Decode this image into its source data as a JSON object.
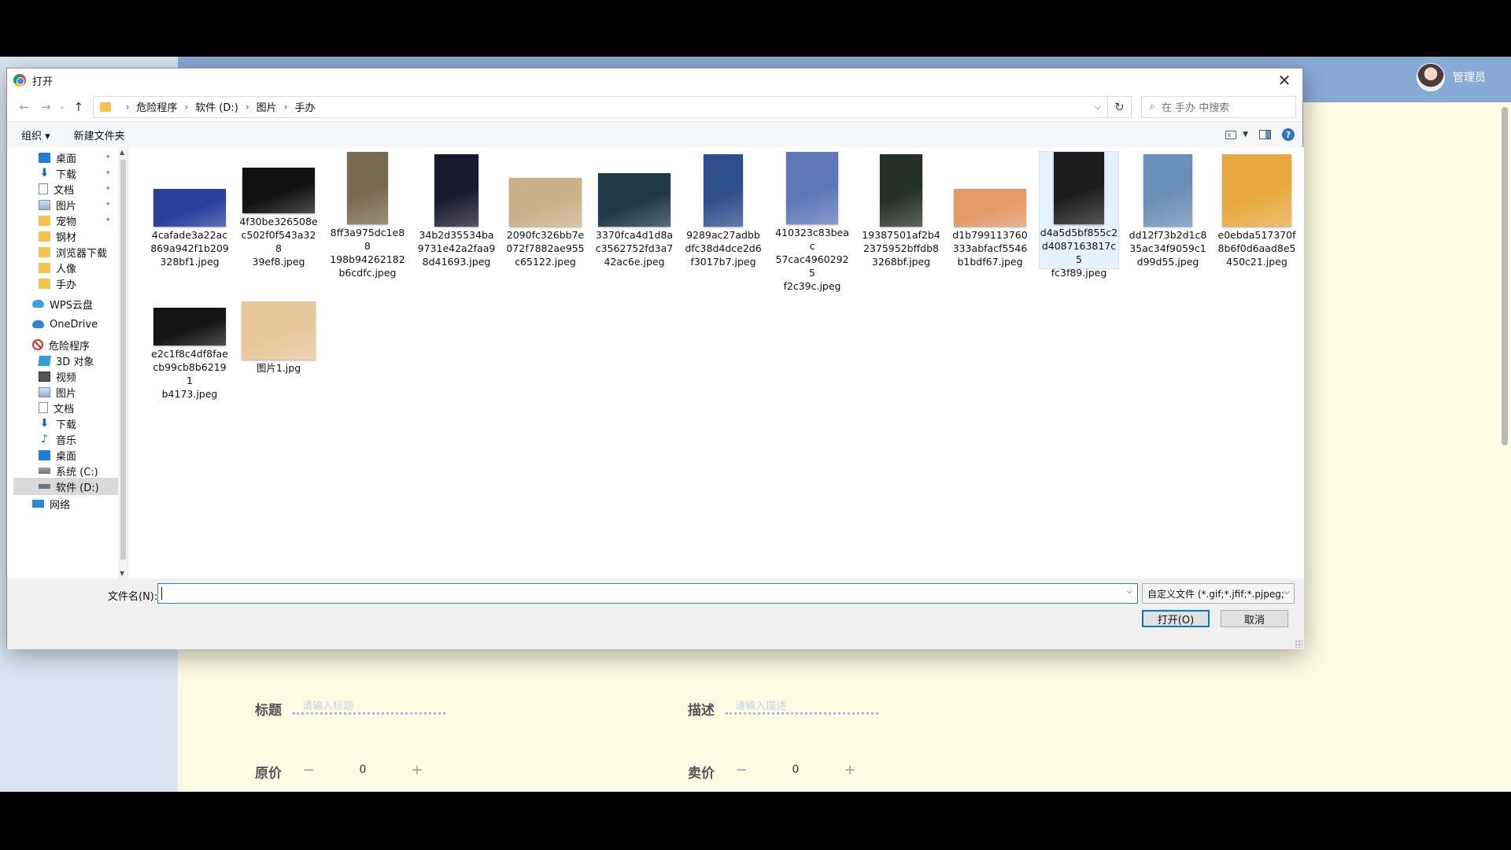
{
  "app": {
    "user_name": "管理员",
    "form": {
      "title_label": "标题",
      "title_placeholder": "请输入标题",
      "desc_label": "描述",
      "desc_placeholder": "请输入描述",
      "orig_price_label": "原价",
      "orig_price_value": "0",
      "sale_price_label": "卖价",
      "sale_price_value": "0",
      "minus": "−",
      "plus": "+"
    }
  },
  "dialog": {
    "title": "打开",
    "close": "✕",
    "nav": {
      "back": "←",
      "forward": "→",
      "recent": "⌄",
      "up": "↑"
    },
    "breadcrumb": [
      "危险程序",
      "软件 (D:)",
      "图片",
      "手办"
    ],
    "crumb_sep": "›",
    "address_dropdown": "⌵",
    "refresh": "↻",
    "search_placeholder": "在 手办 中搜索",
    "search_icon": "⌕",
    "toolbar": {
      "organize": "组织 ▾",
      "new_folder": "新建文件夹",
      "help": "?"
    },
    "sidebar": [
      {
        "label": "桌面",
        "icon": "desktop-icon",
        "pinned": true
      },
      {
        "label": "下载",
        "icon": "download-icon",
        "pinned": true
      },
      {
        "label": "文档",
        "icon": "document-icon",
        "pinned": true
      },
      {
        "label": "图片",
        "icon": "picture-icon",
        "pinned": true
      },
      {
        "label": "宠物",
        "icon": "folder-icon",
        "pinned": true
      },
      {
        "label": "钢材",
        "icon": "folder-icon",
        "pinned": false
      },
      {
        "label": "浏览器下载",
        "icon": "folder-icon",
        "pinned": false
      },
      {
        "label": "人像",
        "icon": "folder-icon",
        "pinned": false
      },
      {
        "label": "手办",
        "icon": "folder-icon",
        "pinned": false
      },
      {
        "label": "WPS云盘",
        "icon": "wps-cloud-icon",
        "pinned": false
      },
      {
        "label": "OneDrive",
        "icon": "onedrive-icon",
        "pinned": false
      },
      {
        "label": "危险程序",
        "icon": "blocked-icon",
        "pinned": false
      },
      {
        "label": "3D 对象",
        "icon": "3d-objects-icon",
        "pinned": false
      },
      {
        "label": "视频",
        "icon": "video-icon",
        "pinned": false
      },
      {
        "label": "图片",
        "icon": "picture-icon",
        "pinned": false
      },
      {
        "label": "文档",
        "icon": "document-icon",
        "pinned": false
      },
      {
        "label": "下载",
        "icon": "download-icon",
        "pinned": false
      },
      {
        "label": "音乐",
        "icon": "music-icon",
        "pinned": false
      },
      {
        "label": "桌面",
        "icon": "desktop-icon",
        "pinned": false
      },
      {
        "label": "系统 (C:)",
        "icon": "drive-c-icon",
        "pinned": false
      },
      {
        "label": "软件 (D:)",
        "icon": "drive-d-icon",
        "pinned": false,
        "selected": true
      },
      {
        "label": "网络",
        "icon": "network-icon",
        "pinned": false
      }
    ],
    "pin_glyph": "📌",
    "files": [
      {
        "name": "4cafade3a22ac869a942f1b209328bf1.jpeg",
        "line1": "4cafade3a22ac",
        "line2": "869a942f1b209",
        "line3": "328bf1.jpeg",
        "color": "#2a3f9c"
      },
      {
        "name": "4f30be326508ec502f0f543a32839ef8.jpeg",
        "line1": "4f30be326508e",
        "line2": "c502f0f543a328",
        "line3": "39ef8.jpeg",
        "color": "#111111"
      },
      {
        "name": "8ff3a975dc1e88198b94262182b6cdfc.jpeg",
        "line1": "8ff3a975dc1e88",
        "line2": "198b94262182",
        "line3": "b6cdfc.jpeg",
        "color": "#7a6a50"
      },
      {
        "name": "34b2d35534ba9731e42a2faa98d41693.jpeg",
        "line1": "34b2d35534ba",
        "line2": "9731e42a2faa9",
        "line3": "8d41693.jpeg",
        "color": "#1a1a2e"
      },
      {
        "name": "2090fc326bb7e072f7882ae955c65122.jpeg",
        "line1": "2090fc326bb7e",
        "line2": "072f7882ae955",
        "line3": "c65122.jpeg",
        "color": "#c9b28a"
      },
      {
        "name": "3370fca4d1d8ac3562752fd3a742ac6e.jpeg",
        "line1": "3370fca4d1d8a",
        "line2": "c3562752fd3a7",
        "line3": "42ac6e.jpeg",
        "color": "#1f3a44"
      },
      {
        "name": "9289ac27adbbdfc38d4dce2d6f3017b7.jpeg",
        "line1": "9289ac27adbb",
        "line2": "dfc38d4dce2d6",
        "line3": "f3017b7.jpeg",
        "color": "#2e4e8c"
      },
      {
        "name": "410323c83beac57cac49602925f2c39c.jpeg",
        "line1": "410323c83beac",
        "line2": "57cac49602925",
        "line3": "f2c39c.jpeg",
        "color": "#5f77b8"
      },
      {
        "name": "19387501af2b42375952bffdb83268bf.jpeg",
        "line1": "19387501af2b4",
        "line2": "2375952bffdb8",
        "line3": "3268bf.jpeg",
        "color": "#253028"
      },
      {
        "name": "d1b799113760333abfacf5546b1bdf67.jpeg",
        "line1": "d1b799113760",
        "line2": "333abfacf5546",
        "line3": "b1bdf67.jpeg",
        "color": "#e39a6b"
      },
      {
        "name": "d4a5d5bf855c2d4087163817c5fc3f89.jpeg",
        "line1": "d4a5d5bf855c2",
        "line2": "d4087163817c5",
        "line3": "fc3f89.jpeg",
        "color": "#1c1c1c",
        "selected": true
      },
      {
        "name": "dd12f73b2d1c835ac34f9059c1d99d55.jpeg",
        "line1": "dd12f73b2d1c8",
        "line2": "35ac34f9059c1",
        "line3": "d99d55.jpeg",
        "color": "#6a8fb6"
      },
      {
        "name": "e0ebda517370f8b6f0d6aad8e5450c21.jpeg",
        "line1": "e0ebda517370f",
        "line2": "8b6f0d6aad8e5",
        "line3": "450c21.jpeg",
        "color": "#e7a93f"
      },
      {
        "name": "e2c1f8c4df8faecb99cb8b62191b4173.jpeg",
        "line1": "e2c1f8c4df8fae",
        "line2": "cb99cb8b62191",
        "line3": "b4173.jpeg",
        "color": "#141414"
      },
      {
        "name": "图片1.jpg",
        "line1": "图片1.jpg",
        "line2": "",
        "line3": "",
        "color": "#e6c79a"
      }
    ],
    "filename_label": "文件名(N):",
    "filename_value": "",
    "filetype": "自定义文件 (*.gif;*.jfif;*.pjpeg;",
    "open_button": "打开(O)",
    "cancel_button": "取消"
  }
}
